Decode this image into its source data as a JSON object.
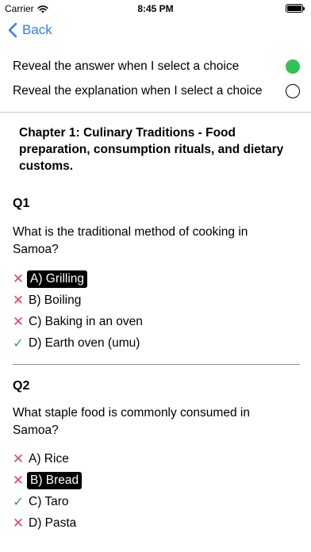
{
  "status_bar": {
    "carrier": "Carrier",
    "time": "8:45 PM"
  },
  "nav": {
    "back_label": "Back",
    "accent_color": "#2f7cf6"
  },
  "settings": {
    "reveal_answer": {
      "label": "Reveal the answer when I select a choice",
      "on": true
    },
    "reveal_explanation": {
      "label": "Reveal the explanation when I select a choice",
      "on": false
    }
  },
  "chapter": {
    "title": "Chapter 1: Culinary Traditions - Food preparation, consumption rituals, and dietary customs."
  },
  "questions": [
    {
      "number": "Q1",
      "text": "What is the traditional method of cooking in Samoa?",
      "choices": [
        {
          "label": "A) Grilling",
          "correct": false,
          "selected": true
        },
        {
          "label": "B) Boiling",
          "correct": false,
          "selected": false
        },
        {
          "label": "C) Baking in an oven",
          "correct": false,
          "selected": false
        },
        {
          "label": "D) Earth oven (umu)",
          "correct": true,
          "selected": false
        }
      ]
    },
    {
      "number": "Q2",
      "text": "What staple food is commonly consumed in Samoa?",
      "choices": [
        {
          "label": "A) Rice",
          "correct": false,
          "selected": false
        },
        {
          "label": "B) Bread",
          "correct": false,
          "selected": true
        },
        {
          "label": "C) Taro",
          "correct": true,
          "selected": false
        },
        {
          "label": "D) Pasta",
          "correct": false,
          "selected": false
        }
      ]
    }
  ],
  "colors": {
    "toggle_on": "#2fc254",
    "wrong_mark": "#e5455a",
    "correct_mark": "#2fa34a"
  }
}
